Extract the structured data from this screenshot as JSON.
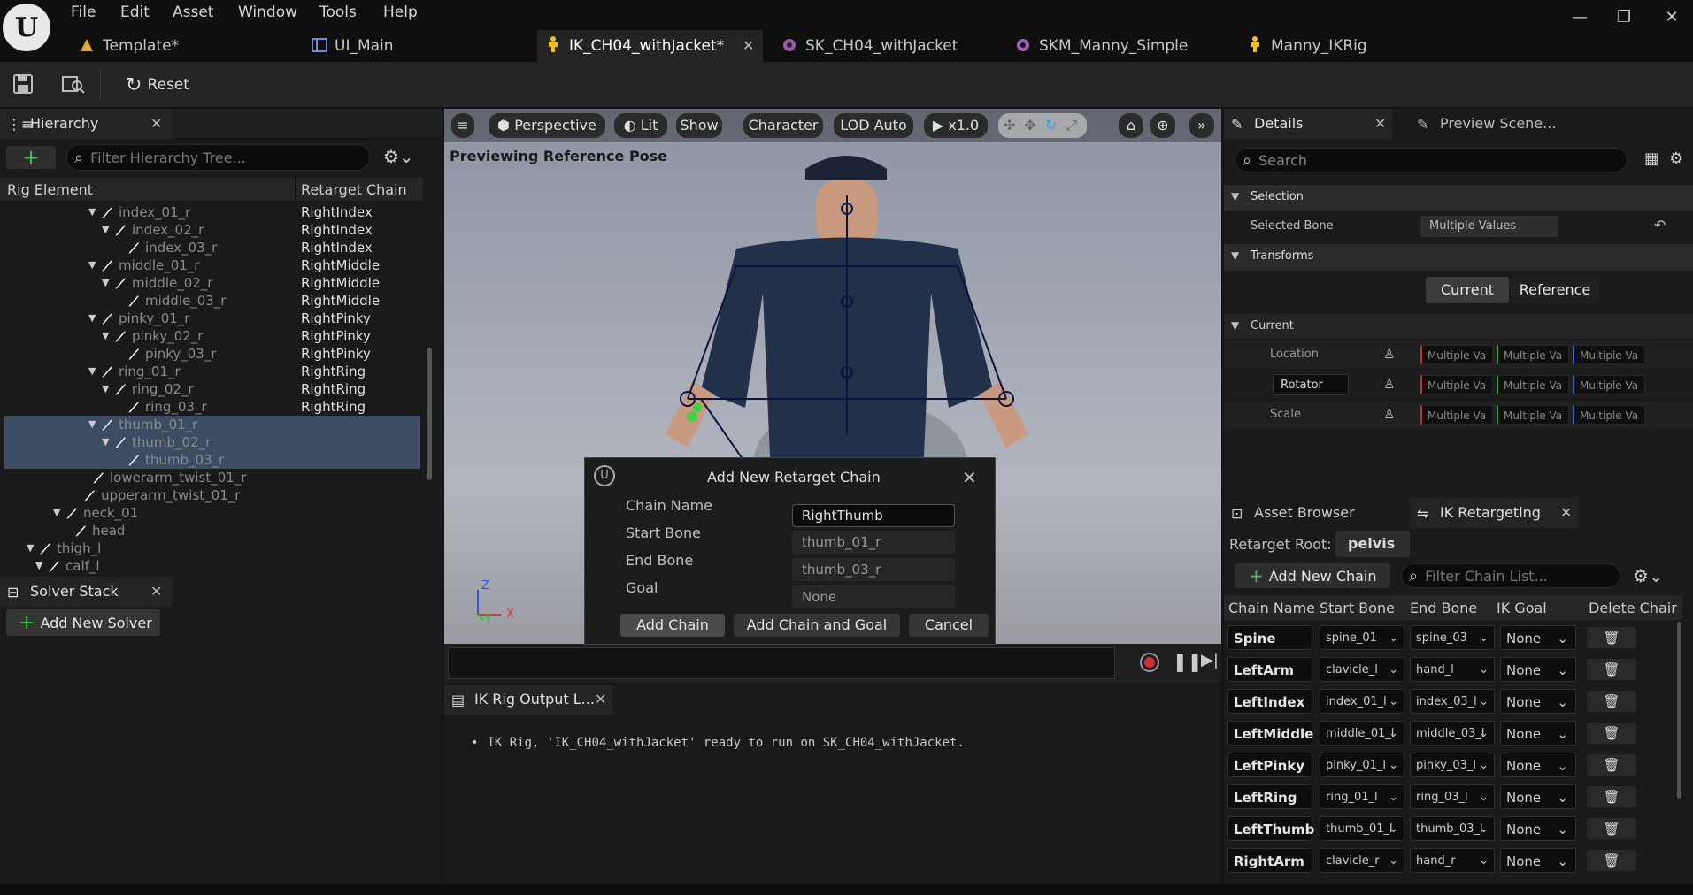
{
  "menu": [
    "File",
    "Edit",
    "Asset",
    "Window",
    "Tools",
    "Help"
  ],
  "tabs": [
    {
      "label": "Template*",
      "active": false,
      "icon": "level-icon"
    },
    {
      "label": "UI_Main",
      "active": false,
      "icon": "widget-icon"
    },
    {
      "label": "IK_CH04_withJacket*",
      "active": true,
      "icon": "ikrig-icon"
    },
    {
      "label": "SK_CH04_withJacket",
      "active": false,
      "icon": "skeleton-icon"
    },
    {
      "label": "SKM_Manny_Simple",
      "active": false,
      "icon": "skeletal-mesh-icon"
    },
    {
      "label": "Manny_IKRig",
      "active": false,
      "icon": "ikrig-icon"
    }
  ],
  "toolbar": {
    "reset_label": "Reset"
  },
  "hierarchy": {
    "title": "Hierarchy",
    "filter_placeholder": "Filter Hierarchy Tree...",
    "col_element": "Rig Element",
    "col_chain": "Retarget Chain",
    "rows": [
      {
        "name": "index_01_r",
        "chain": "RightIndex"
      },
      {
        "name": "index_02_r",
        "chain": "RightIndex"
      },
      {
        "name": "index_03_r",
        "chain": "RightIndex"
      },
      {
        "name": "middle_01_r",
        "chain": "RightMiddle"
      },
      {
        "name": "middle_02_r",
        "chain": "RightMiddle"
      },
      {
        "name": "middle_03_r",
        "chain": "RightMiddle"
      },
      {
        "name": "pinky_01_r",
        "chain": "RightPinky"
      },
      {
        "name": "pinky_02_r",
        "chain": "RightPinky"
      },
      {
        "name": "pinky_03_r",
        "chain": "RightPinky"
      },
      {
        "name": "ring_01_r",
        "chain": "RightRing"
      },
      {
        "name": "ring_02_r",
        "chain": "RightRing"
      },
      {
        "name": "ring_03_r",
        "chain": "RightRing"
      },
      {
        "name": "thumb_01_r",
        "chain": ""
      },
      {
        "name": "thumb_02_r",
        "chain": ""
      },
      {
        "name": "thumb_03_r",
        "chain": ""
      },
      {
        "name": "lowerarm_twist_01_r",
        "chain": ""
      },
      {
        "name": "upperarm_twist_01_r",
        "chain": ""
      },
      {
        "name": "neck_01",
        "chain": ""
      },
      {
        "name": "head",
        "chain": ""
      },
      {
        "name": "thigh_l",
        "chain": ""
      },
      {
        "name": "calf_l",
        "chain": ""
      }
    ]
  },
  "solver": {
    "title": "Solver Stack",
    "add_label": "Add New Solver"
  },
  "viewport": {
    "perspective": "Perspective",
    "lit": "Lit",
    "show": "Show",
    "character": "Character",
    "lod": "LOD Auto",
    "speed": "x1.0",
    "preview_text": "Previewing Reference Pose",
    "axis_z": "Z",
    "axis_x": "X",
    "axis_y": "Y"
  },
  "dialog": {
    "title": "Add New Retarget Chain",
    "fields": [
      {
        "label": "Chain Name",
        "value": "RightThumb"
      },
      {
        "label": "Start Bone",
        "value": "thumb_01_r"
      },
      {
        "label": "End Bone",
        "value": "thumb_03_r"
      },
      {
        "label": "Goal",
        "value": "None"
      }
    ],
    "add_chain": "Add Chain",
    "add_chain_goal": "Add Chain and Goal",
    "cancel": "Cancel"
  },
  "output": {
    "title": "IK Rig Output L...",
    "message": "IK Rig, 'IK_CH04_withJacket' ready to run on SK_CH04_withJacket."
  },
  "details": {
    "title": "Details",
    "preview_tab": "Preview Scene...",
    "search_placeholder": "Search",
    "selection": "Selection",
    "selected_bone_label": "Selected Bone",
    "selected_bone_value": "Multiple Values",
    "transforms": "Transforms",
    "current_btn": "Current",
    "reference_btn": "Reference",
    "current_section": "Current",
    "location": "Location",
    "rotator": "Rotator",
    "scale": "Scale",
    "multi": "Multiple Va"
  },
  "retarget": {
    "asset_browser": "Asset Browser",
    "ik_tab": "IK Retargeting",
    "root_label": "Retarget Root:",
    "root_value": "pelvis",
    "add_chain": "Add New Chain",
    "filter_placeholder": "Filter Chain List...",
    "headers": [
      "Chain Name",
      "Start Bone",
      "End Bone",
      "IK Goal",
      "Delete Chair"
    ],
    "rows": [
      {
        "name": "Spine",
        "start": "spine_01",
        "end": "spine_03",
        "goal": "None"
      },
      {
        "name": "LeftArm",
        "start": "clavicle_l",
        "end": "hand_l",
        "goal": "None"
      },
      {
        "name": "LeftIndex",
        "start": "index_01_l",
        "end": "index_03_l",
        "goal": "None"
      },
      {
        "name": "LeftMiddle",
        "start": "middle_01_l",
        "end": "middle_03_l",
        "goal": "None"
      },
      {
        "name": "LeftPinky",
        "start": "pinky_01_l",
        "end": "pinky_03_l",
        "goal": "None"
      },
      {
        "name": "LeftRing",
        "start": "ring_01_l",
        "end": "ring_03_l",
        "goal": "None"
      },
      {
        "name": "LeftThumb",
        "start": "thumb_01_l",
        "end": "thumb_03_l",
        "goal": "None"
      },
      {
        "name": "RightArm",
        "start": "clavicle_r",
        "end": "hand_r",
        "goal": "None"
      }
    ]
  }
}
